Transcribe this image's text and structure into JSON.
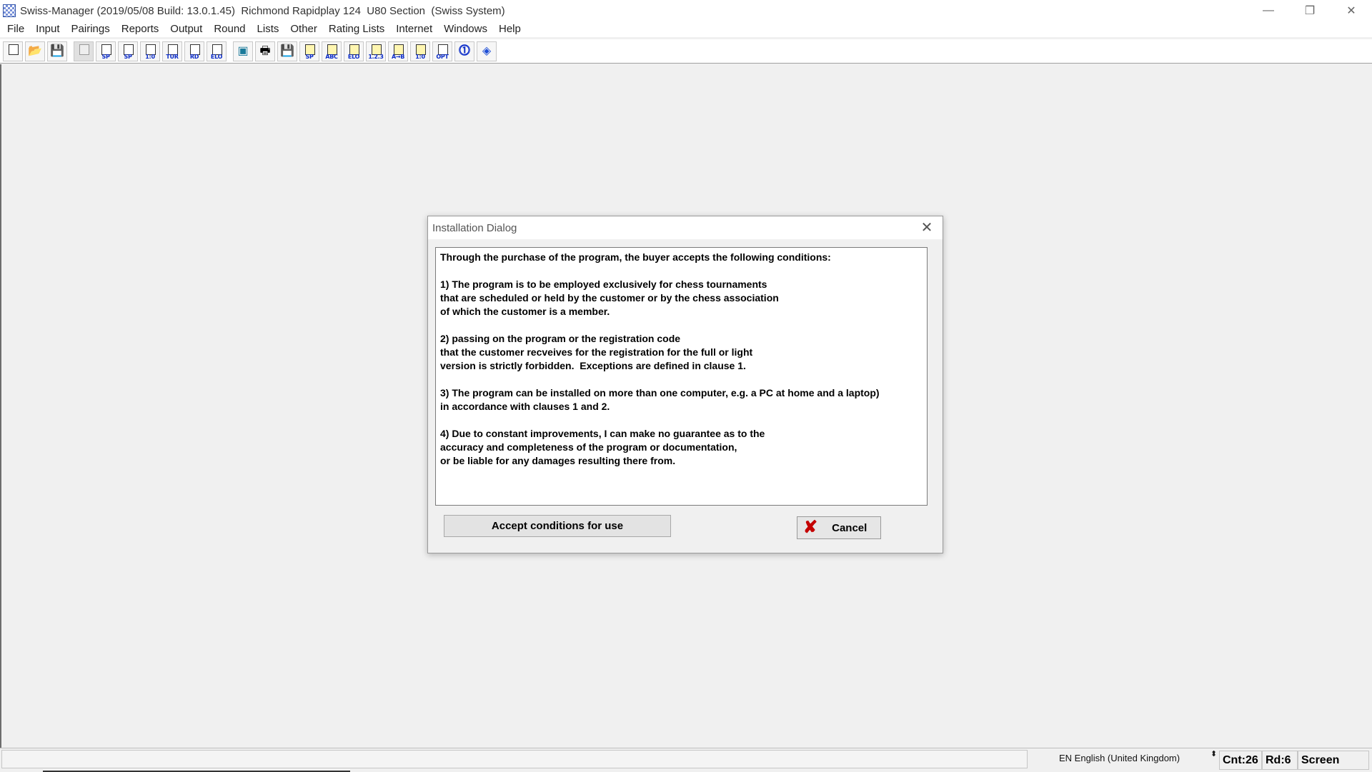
{
  "window": {
    "title": "Swiss-Manager (2019/05/08 Build: 13.0.1.45)  Richmond Rapidplay 124  U80 Section  (Swiss System)",
    "minimize_glyph": "—",
    "maximize_glyph": "❐",
    "close_glyph": "✕"
  },
  "menu": {
    "items": [
      "File",
      "Input",
      "Pairings",
      "Reports",
      "Output",
      "Round",
      "Lists",
      "Other",
      "Rating Lists",
      "Internet",
      "Windows",
      "Help"
    ]
  },
  "toolbar": {
    "buttons": [
      {
        "icon": "new-document-icon",
        "label": ""
      },
      {
        "icon": "open-folder-icon",
        "label": ""
      },
      {
        "icon": "save-disk-icon",
        "label": ""
      },
      {
        "icon": "disabled-grid-icon",
        "label": ""
      },
      {
        "icon": "starting-list-icon",
        "label": "SP"
      },
      {
        "icon": "starting-rank-icon",
        "label": "SP"
      },
      {
        "icon": "results-icon",
        "label": "1:0"
      },
      {
        "icon": "tournament-icon",
        "label": "TUR"
      },
      {
        "icon": "round-icon",
        "label": "RD"
      },
      {
        "icon": "elo-icon",
        "label": "ELO"
      },
      {
        "icon": "screen-preview-icon",
        "label": ""
      },
      {
        "icon": "print-icon",
        "label": ""
      },
      {
        "icon": "save-output-icon",
        "label": ""
      },
      {
        "icon": "starting-list-doc-icon",
        "label": "SP"
      },
      {
        "icon": "sort-alpha-icon",
        "label": "ABC"
      },
      {
        "icon": "sort-elo-icon",
        "label": "ELO"
      },
      {
        "icon": "sort-number-icon",
        "label": "1.2.3"
      },
      {
        "icon": "sort-a-b-icon",
        "label": "A→B"
      },
      {
        "icon": "result-doc-icon",
        "label": "1:0"
      },
      {
        "icon": "options-icon",
        "label": "OPT"
      },
      {
        "icon": "internet-upload-icon",
        "label": ""
      },
      {
        "icon": "chess-results-icon",
        "label": ""
      }
    ]
  },
  "dialog": {
    "title": "Installation Dialog",
    "close_glyph": "✕",
    "terms": [
      "Through the purchase of the program, the buyer accepts the following conditions:",
      "",
      "1) The program is to be employed exclusively for chess tournaments",
      "that are scheduled or held by the customer or by the chess association",
      "of which the customer is a member.",
      "",
      "2) passing on the program or the registration code",
      "that the customer recveives for the registration for the full or light",
      "version is strictly forbidden.  Exceptions are defined in clause 1.",
      "",
      "3) The program can be installed on more than one computer, e.g. a PC at home and a laptop)",
      "in accordance with clauses 1 and 2.",
      "",
      "4) Due to constant improvements, I can make no guarantee as to the",
      "accuracy and completeness of the program or documentation,",
      "or be liable for any damages resulting there from."
    ],
    "accept_label": "Accept conditions for use",
    "cancel_label": "Cancel",
    "cancel_icon_glyph": "✘"
  },
  "statusbar": {
    "language": "EN English (United Kingdom)",
    "language_arrows": "⬍",
    "count": "Cnt:26",
    "round": "Rd:6",
    "mode": "Screen"
  }
}
